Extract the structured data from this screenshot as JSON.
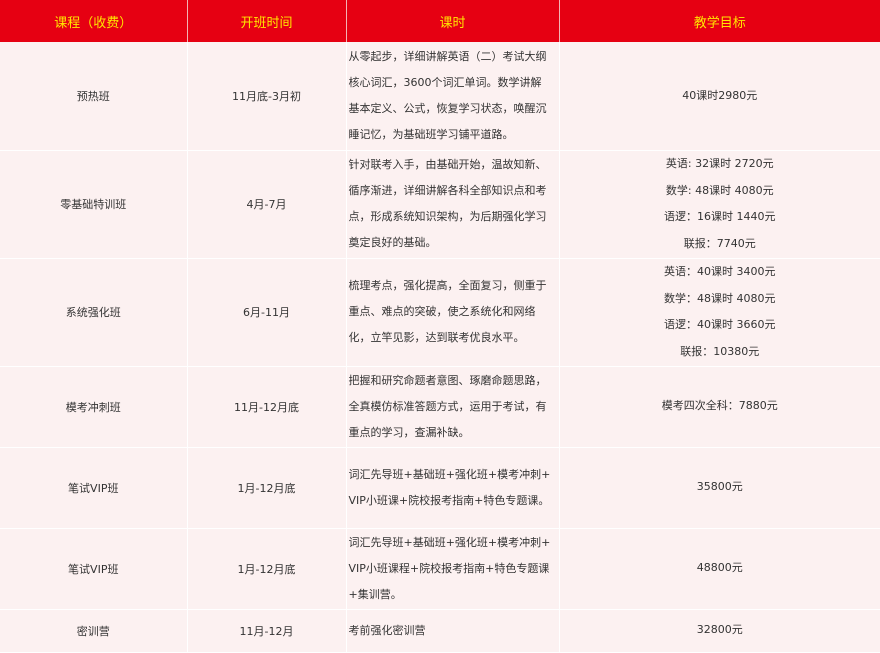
{
  "header": {
    "course": "课程（收费）",
    "time": "开班时间",
    "hours": "课时",
    "goal": "教学目标"
  },
  "rows": [
    {
      "course": "预热班",
      "time": "11月底-3月初",
      "desc": "从零起步，详细讲解英语（二）考试大纲核心词汇，3600个词汇单词。数学讲解基本定义、公式，恢复学习状态，唤醒沉睡记忆，为基础班学习铺平道路。",
      "goals": [
        "40课时2980元"
      ]
    },
    {
      "course": "零基础特训班",
      "time": "4月-7月",
      "desc": "针对联考入手，由基础开始，温故知新、循序渐进，详细讲解各科全部知识点和考点，形成系统知识架构，为后期强化学习奠定良好的基础。",
      "goals": [
        "英语: 32课时 2720元",
        "数学: 48课时 4080元",
        "语逻：16课时 1440元",
        "联报：7740元"
      ]
    },
    {
      "course": "系统强化班",
      "time": "6月-11月",
      "desc": "梳理考点，强化提高，全面复习，侧重于重点、难点的突破，使之系统化和网络化，立竿见影，达到联考优良水平。",
      "goals": [
        "英语：40课时 3400元",
        "数学：48课时 4080元",
        "语逻：40课时 3660元",
        "联报：10380元"
      ]
    },
    {
      "course": "模考冲刺班",
      "time": "11月-12月底",
      "desc": "把握和研究命题者意图、琢磨命题思路，全真模仿标准答题方式，运用于考试，有重点的学习，查漏补缺。",
      "goals": [
        "模考四次全科：7880元"
      ]
    },
    {
      "course": "笔试VIP班",
      "time": "1月-12月底",
      "desc": "词汇先导班+基础班+强化班+模考冲刺+VIP小班课+院校报考指南+特色专题课。",
      "goals": [
        "35800元"
      ]
    },
    {
      "course": "笔试VIP班",
      "time": "1月-12月底",
      "desc": "词汇先导班+基础班+强化班+模考冲刺+VIP小班课程+院校报考指南+特色专题课+集训营。",
      "goals": [
        "48800元"
      ]
    },
    {
      "course": "密训营",
      "time": "11月-12月",
      "desc": "考前强化密训营",
      "goals": [
        "32800元"
      ]
    }
  ]
}
